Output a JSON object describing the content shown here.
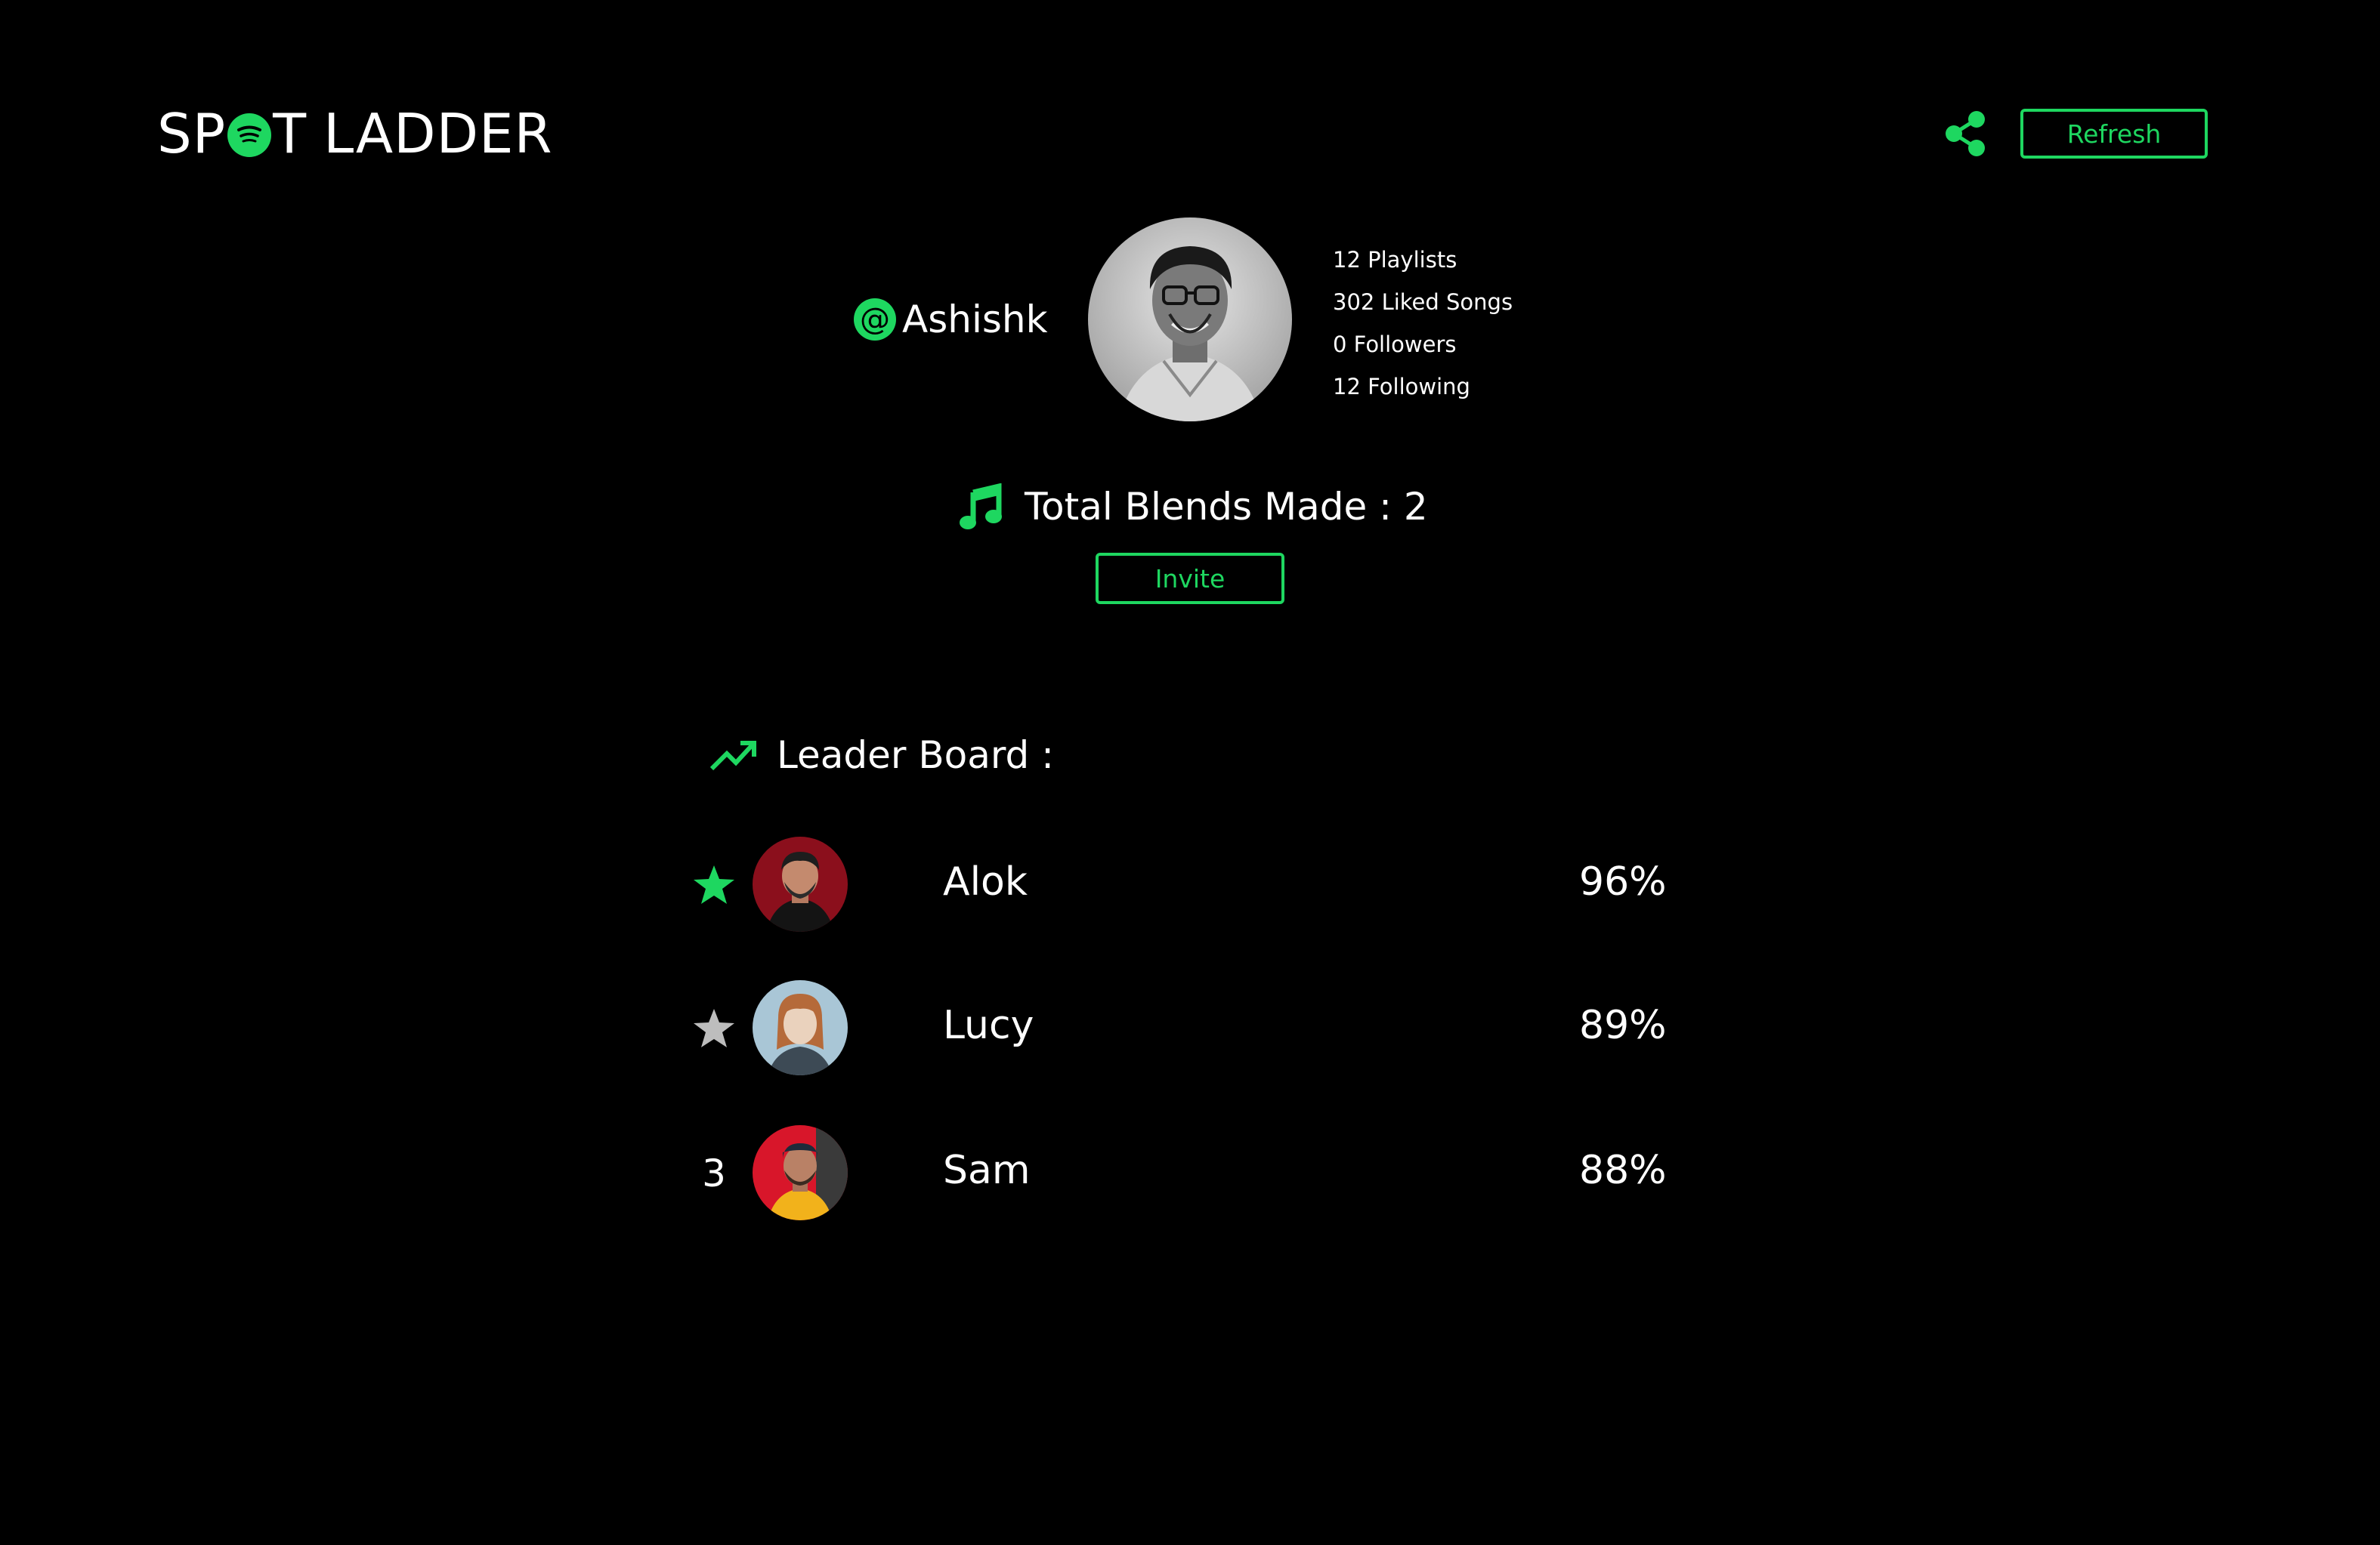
{
  "colors": {
    "background": "#000000",
    "accent": "#1ed760",
    "text": "#ffffff",
    "silver": "#bdbdbd"
  },
  "header": {
    "logo_part1": "SP",
    "logo_part2": "T",
    "logo_part3": "LADDER",
    "logo_icon": "spotify-icon",
    "share_icon": "share-icon",
    "refresh_label": "Refresh"
  },
  "profile": {
    "at_symbol": "@",
    "username": "Ashishk",
    "avatar_icon": "user-avatar",
    "stats": [
      "12 Playlists",
      "302 Liked Songs",
      "0 Followers",
      "12 Following"
    ]
  },
  "blends": {
    "icon": "music-note-icon",
    "label": "Total Blends Made : 2",
    "invite_label": "Invite"
  },
  "leaderboard": {
    "icon": "trending-up-icon",
    "title": "Leader Board :",
    "rows": [
      {
        "rank_icon": "star-icon",
        "rank_color": "#1ed760",
        "name": "Alok",
        "score": "96%"
      },
      {
        "rank_icon": "star-icon",
        "rank_color": "#bdbdbd",
        "name": "Lucy",
        "score": "89%"
      },
      {
        "rank": "3",
        "name": "Sam",
        "score": "88%"
      }
    ]
  }
}
